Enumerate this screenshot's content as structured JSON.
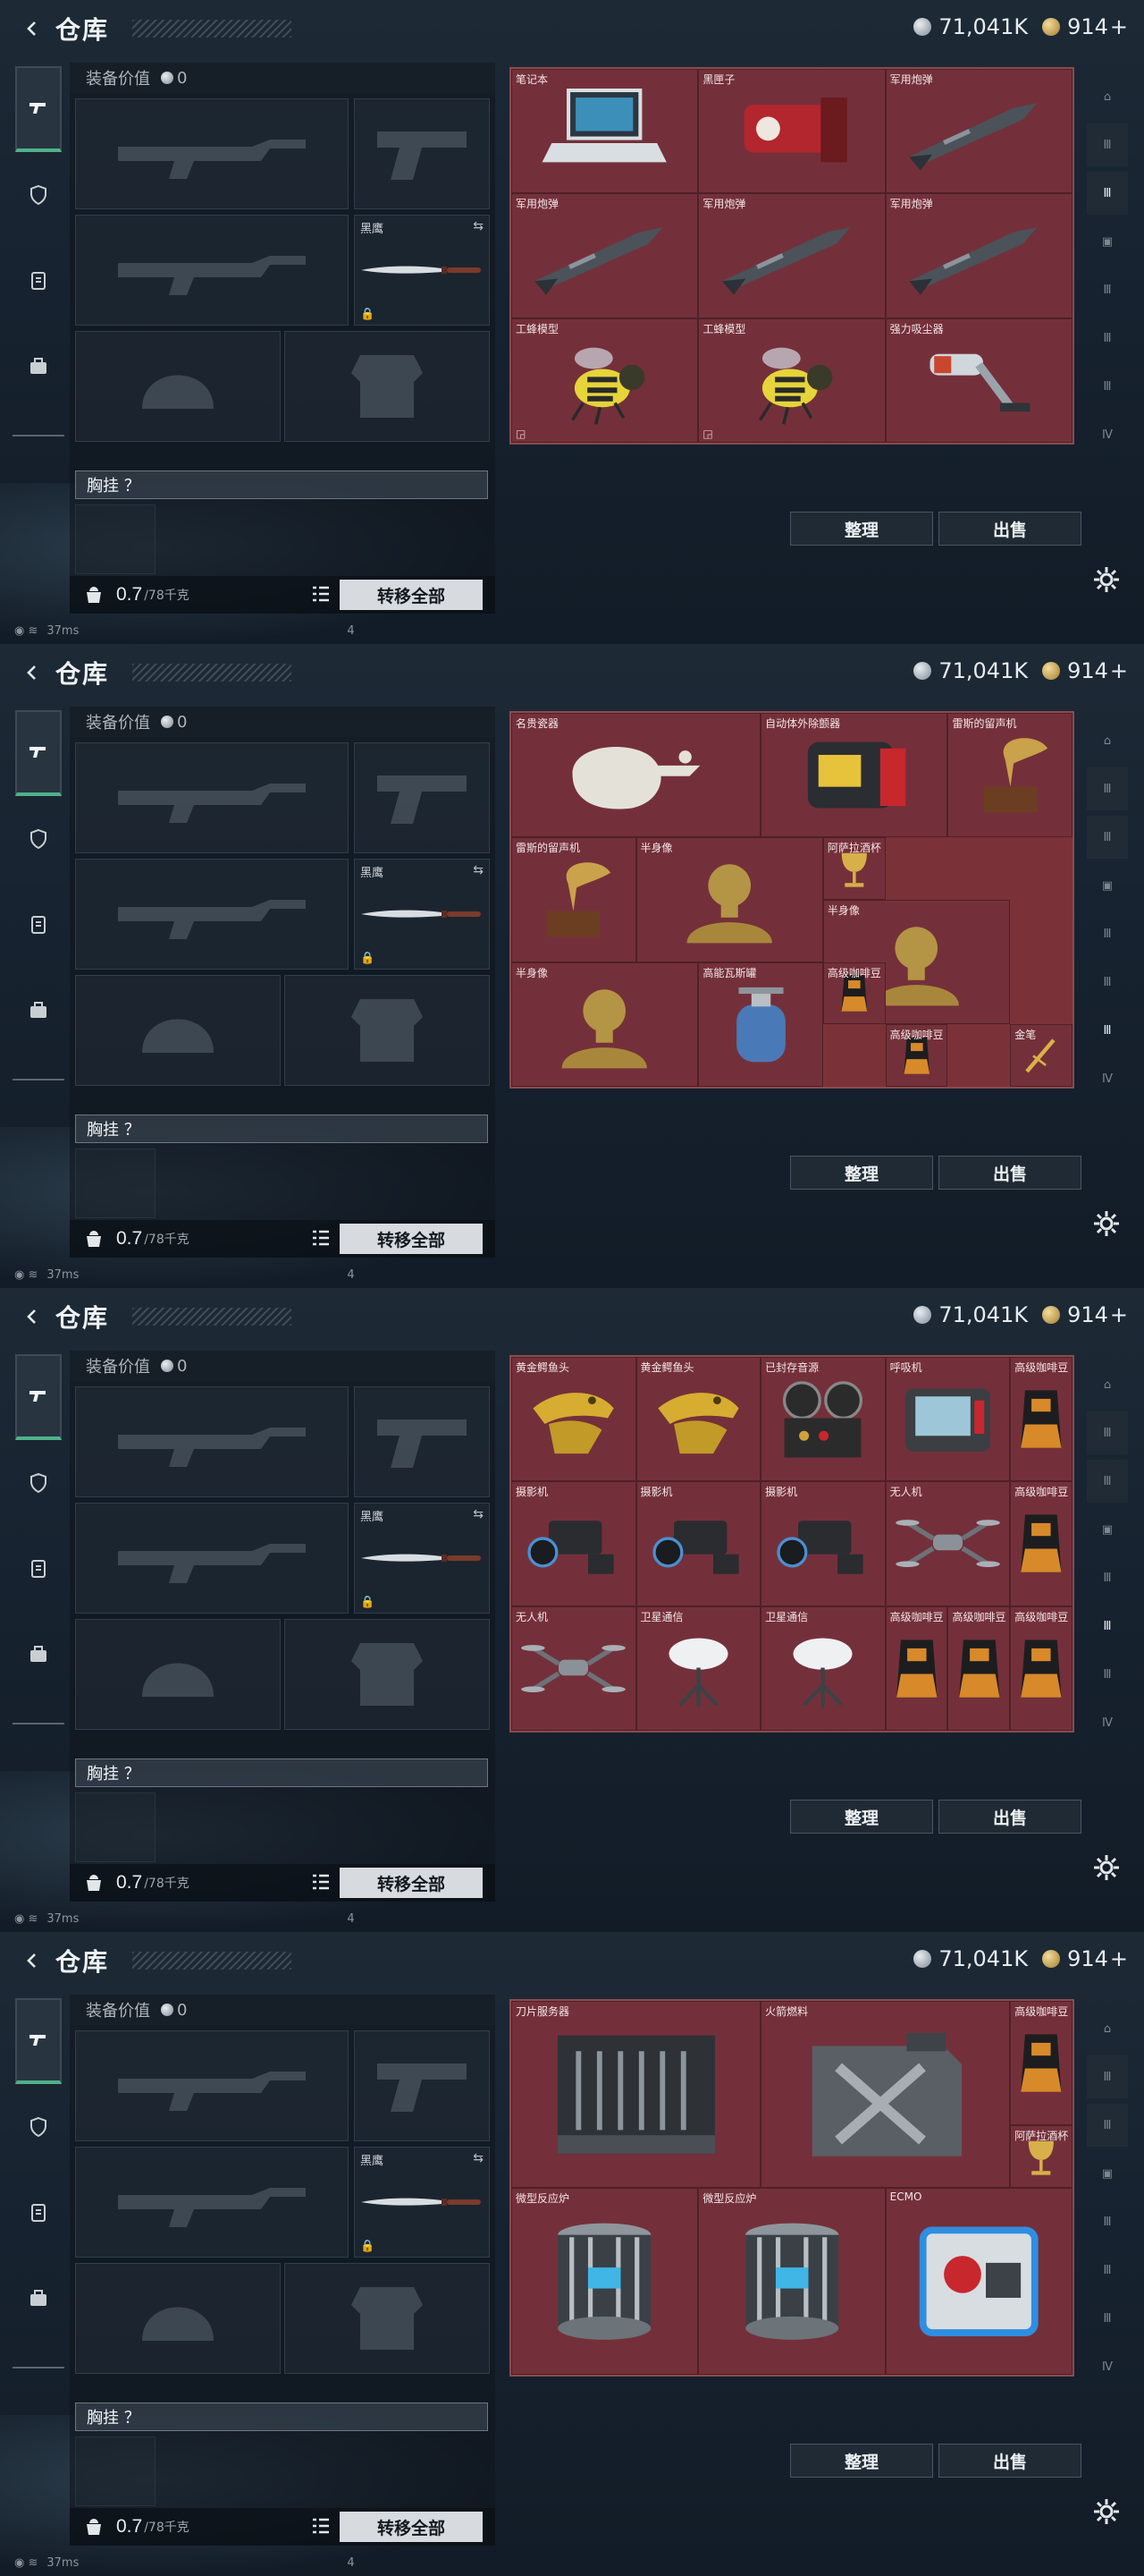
{
  "header": {
    "title": "仓库",
    "silver": "71,041K",
    "gold": "914",
    "gold_plus": "+"
  },
  "equip": {
    "value_label": "装备价值",
    "value": "0",
    "knife_name": "黑鹰",
    "chest_rig": "胸挂 ？",
    "weight": "0.7",
    "weight_unit": "/78千克",
    "transfer_label": "转移全部"
  },
  "actions": {
    "sort": "整理",
    "sell": "出售"
  },
  "status": {
    "ping": "37ms",
    "left": "4"
  },
  "panels": [
    {
      "items": [
        {
          "name": "笔记本",
          "col": 1,
          "row": 1,
          "w": 3,
          "h": 2,
          "icon": "laptop"
        },
        {
          "name": "黑匣子",
          "col": 4,
          "row": 1,
          "w": 3,
          "h": 2,
          "icon": "blackbox"
        },
        {
          "name": "军用炮弹",
          "col": 7,
          "row": 1,
          "w": 3,
          "h": 2,
          "icon": "shell"
        },
        {
          "name": "军用炮弹",
          "col": 1,
          "row": 3,
          "w": 3,
          "h": 2,
          "icon": "shell"
        },
        {
          "name": "军用炮弹",
          "col": 4,
          "row": 3,
          "w": 3,
          "h": 2,
          "icon": "shell"
        },
        {
          "name": "军用炮弹",
          "col": 7,
          "row": 3,
          "w": 3,
          "h": 2,
          "icon": "shell"
        },
        {
          "name": "工蜂模型",
          "col": 1,
          "row": 5,
          "w": 3,
          "h": 2,
          "icon": "bee",
          "tag": "◲"
        },
        {
          "name": "工蜂模型",
          "col": 4,
          "row": 5,
          "w": 3,
          "h": 2,
          "icon": "bee",
          "tag": "◲"
        },
        {
          "name": "强力吸尘器",
          "col": 7,
          "row": 5,
          "w": 3,
          "h": 2,
          "icon": "vacuum"
        }
      ]
    },
    {
      "items": [
        {
          "name": "名贵瓷器",
          "col": 1,
          "row": 1,
          "w": 4,
          "h": 2,
          "icon": "vase"
        },
        {
          "name": "自动体外除颤器",
          "col": 5,
          "row": 1,
          "w": 3,
          "h": 2,
          "icon": "defib"
        },
        {
          "name": "雷斯的留声机",
          "col": 8,
          "row": 1,
          "w": 2,
          "h": 2,
          "icon": "gramophone"
        },
        {
          "name": "雷斯的留声机",
          "col": 1,
          "row": 3,
          "w": 2,
          "h": 2,
          "icon": "gramophone"
        },
        {
          "name": "半身像",
          "col": 3,
          "row": 3,
          "w": 3,
          "h": 2,
          "icon": "bust"
        },
        {
          "name": "阿萨拉酒杯",
          "col": 6,
          "row": 3,
          "w": 1,
          "h": 1,
          "icon": "goblet"
        },
        {
          "name": "半身像",
          "col": 6,
          "row": 4,
          "w": 3,
          "h": 2,
          "icon": "bust"
        },
        {
          "name": "半身像",
          "col": 1,
          "row": 5,
          "w": 3,
          "h": 2,
          "icon": "bust"
        },
        {
          "name": "高能瓦斯罐",
          "col": 4,
          "row": 5,
          "w": 2,
          "h": 2,
          "icon": "gas"
        },
        {
          "name": "高级咖啡豆",
          "col": 6,
          "row": 5,
          "w": 1,
          "h": 1,
          "icon": "coffee"
        },
        {
          "name": "高级咖啡豆",
          "col": 7,
          "row": 6,
          "w": 1,
          "h": 1,
          "icon": "coffee"
        },
        {
          "name": "金笔",
          "col": 9,
          "row": 6,
          "w": 1,
          "h": 1,
          "icon": "pen"
        }
      ]
    },
    {
      "items": [
        {
          "name": "黄金鳄鱼头",
          "col": 1,
          "row": 1,
          "w": 2,
          "h": 2,
          "icon": "croc"
        },
        {
          "name": "黄金鳄鱼头",
          "col": 3,
          "row": 1,
          "w": 2,
          "h": 2,
          "icon": "croc"
        },
        {
          "name": "已封存音源",
          "col": 5,
          "row": 1,
          "w": 2,
          "h": 2,
          "icon": "reel"
        },
        {
          "name": "呼吸机",
          "col": 7,
          "row": 1,
          "w": 2,
          "h": 2,
          "icon": "ventilator"
        },
        {
          "name": "高级咖啡豆",
          "col": 9,
          "row": 1,
          "w": 1,
          "h": 2,
          "icon": "coffee"
        },
        {
          "name": "摄影机",
          "col": 1,
          "row": 3,
          "w": 2,
          "h": 2,
          "icon": "camera"
        },
        {
          "name": "摄影机",
          "col": 3,
          "row": 3,
          "w": 2,
          "h": 2,
          "icon": "camera"
        },
        {
          "name": "摄影机",
          "col": 5,
          "row": 3,
          "w": 2,
          "h": 2,
          "icon": "camera"
        },
        {
          "name": "无人机",
          "col": 7,
          "row": 3,
          "w": 2,
          "h": 2,
          "icon": "drone"
        },
        {
          "name": "高级咖啡豆",
          "col": 9,
          "row": 3,
          "w": 1,
          "h": 2,
          "icon": "coffee"
        },
        {
          "name": "无人机",
          "col": 1,
          "row": 5,
          "w": 2,
          "h": 2,
          "icon": "drone"
        },
        {
          "name": "卫星通信",
          "col": 3,
          "row": 5,
          "w": 2,
          "h": 2,
          "icon": "dish"
        },
        {
          "name": "卫星通信",
          "col": 5,
          "row": 5,
          "w": 2,
          "h": 2,
          "icon": "dish"
        },
        {
          "name": "高级咖啡豆",
          "col": 7,
          "row": 5,
          "w": 1,
          "h": 2,
          "icon": "coffee"
        },
        {
          "name": "高级咖啡豆",
          "col": 8,
          "row": 5,
          "w": 1,
          "h": 2,
          "icon": "coffee"
        },
        {
          "name": "高级咖啡豆",
          "col": 9,
          "row": 5,
          "w": 1,
          "h": 2,
          "icon": "coffee"
        }
      ]
    },
    {
      "items": [
        {
          "name": "刀片服务器",
          "col": 1,
          "row": 1,
          "w": 4,
          "h": 3,
          "icon": "server"
        },
        {
          "name": "火箭燃料",
          "col": 5,
          "row": 1,
          "w": 4,
          "h": 3,
          "icon": "jerrycan"
        },
        {
          "name": "高级咖啡豆",
          "col": 9,
          "row": 1,
          "w": 1,
          "h": 2,
          "icon": "coffee"
        },
        {
          "name": "阿萨拉酒杯",
          "col": 9,
          "row": 3,
          "w": 1,
          "h": 1,
          "icon": "goblet"
        },
        {
          "name": "微型反应炉",
          "col": 1,
          "row": 4,
          "w": 3,
          "h": 3,
          "icon": "reactor"
        },
        {
          "name": "微型反应炉",
          "col": 4,
          "row": 4,
          "w": 3,
          "h": 3,
          "icon": "reactor"
        },
        {
          "name": "ECMO",
          "col": 7,
          "row": 4,
          "w": 3,
          "h": 3,
          "icon": "ecmo"
        }
      ]
    }
  ],
  "rightnav": [
    "⌂",
    "Ⅲ",
    "Ⅲ",
    "▣",
    "Ⅲ",
    "Ⅲ",
    "Ⅲ",
    "Ⅳ"
  ],
  "rightnav_selected": [
    3,
    7,
    6,
    9
  ],
  "colors": {
    "grid_bg": "#7a3238",
    "accent": "#4fb18a",
    "button_light": "#d7dbdf"
  }
}
